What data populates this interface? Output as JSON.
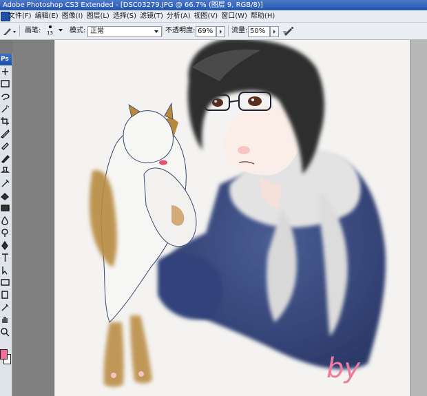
{
  "window": {
    "title": "Adobe Photoshop CS3 Extended - [DSC03279.JPG @ 66.7% (图层 9, RGB/8)]"
  },
  "menu": {
    "items": [
      {
        "label": "文件(F)"
      },
      {
        "label": "编辑(E)"
      },
      {
        "label": "图像(I)"
      },
      {
        "label": "图层(L)"
      },
      {
        "label": "选择(S)"
      },
      {
        "label": "滤镜(T)"
      },
      {
        "label": "分析(A)"
      },
      {
        "label": "视图(V)"
      },
      {
        "label": "窗口(W)"
      },
      {
        "label": "帮助(H)"
      }
    ]
  },
  "options": {
    "brush_label": "画笔:",
    "brush_size": "13",
    "mode_label": "模式:",
    "mode_value": "正常",
    "opacity_label": "不透明度:",
    "opacity_value": "69%",
    "flow_label": "流量:",
    "flow_value": "50%"
  },
  "toolbox": {
    "header": "Ps",
    "tools": [
      "move-tool",
      "marquee-tool",
      "lasso-tool",
      "magic-wand-tool",
      "crop-tool",
      "slice-tool",
      "healing-brush-tool",
      "brush-tool",
      "clone-stamp-tool",
      "history-brush-tool",
      "eraser-tool",
      "gradient-tool",
      "blur-tool",
      "dodge-tool",
      "pen-tool",
      "type-tool",
      "path-selection-tool",
      "shape-tool",
      "notes-tool",
      "eyedropper-tool",
      "hand-tool",
      "zoom-tool"
    ],
    "foreground_color": "#f0709a",
    "background_color": "#ffffff"
  },
  "canvas": {
    "signature": "by"
  }
}
